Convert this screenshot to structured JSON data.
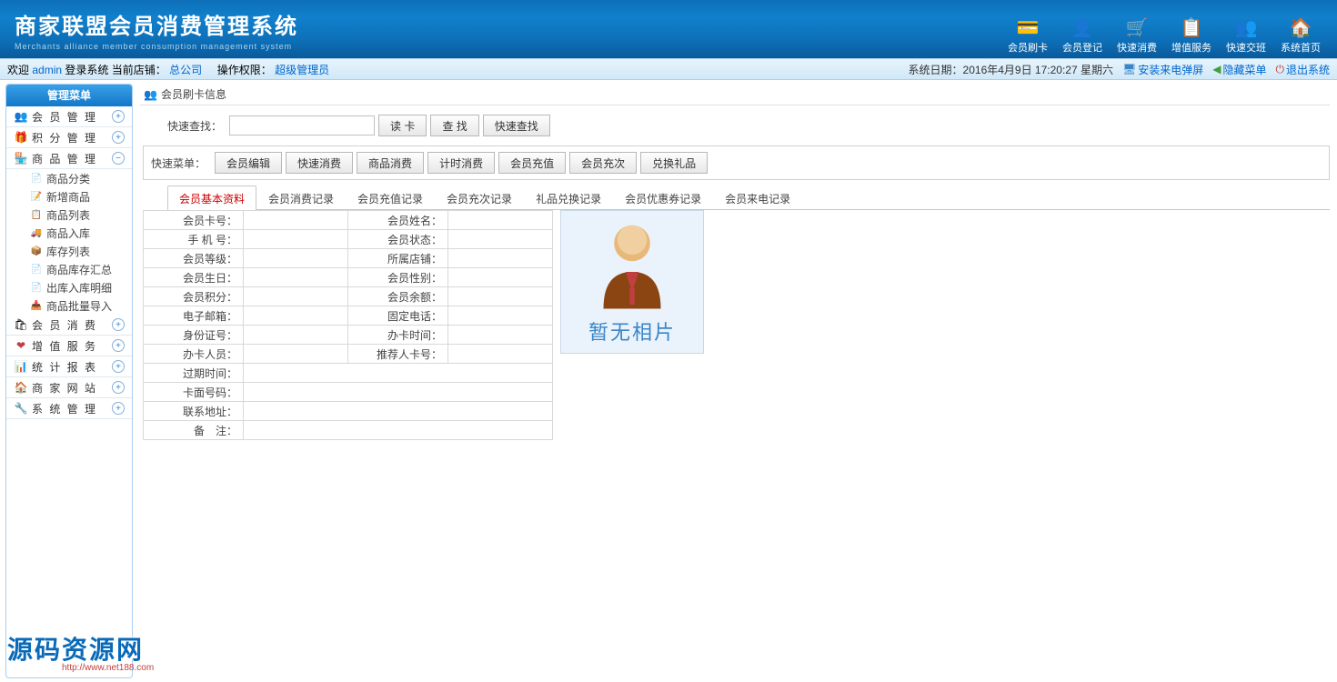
{
  "header": {
    "title_main": "商家联盟会员消费管理系统",
    "title_sub": "Merchants alliance member consumption management system",
    "nav": [
      {
        "label": "会员刷卡",
        "icon": "💳"
      },
      {
        "label": "会员登记",
        "icon": "👤"
      },
      {
        "label": "快速消费",
        "icon": "🛒"
      },
      {
        "label": "增值服务",
        "icon": "📋"
      },
      {
        "label": "快速交班",
        "icon": "👥"
      },
      {
        "label": "系统首页",
        "icon": "🏠"
      }
    ]
  },
  "status": {
    "welcome": "欢迎",
    "user": "admin",
    "login_text": "登录系统",
    "store_label": "当前店铺：",
    "store": "总公司",
    "perm_label": "操作权限：",
    "perm": "超级管理员",
    "date_label": "系统日期：",
    "date": "2016年4月9日 17:20:27 星期六",
    "links": [
      {
        "label": "安装来电弹屏",
        "icon": "🖥"
      },
      {
        "label": "隐藏菜单",
        "icon": "◀"
      },
      {
        "label": "退出系统",
        "icon": "⏻"
      }
    ]
  },
  "sidebar": {
    "title": "管理菜单",
    "items": [
      {
        "label": "会 员 管 理",
        "icon": "👥",
        "icon_class": "ic-brown",
        "expanded": false
      },
      {
        "label": "积 分 管 理",
        "icon": "🎁",
        "icon_class": "ic-orange",
        "expanded": false
      },
      {
        "label": "商 品 管 理",
        "icon": "🏪",
        "icon_class": "ic-brown",
        "expanded": true,
        "children": [
          {
            "label": "商品分类",
            "icon": "📄"
          },
          {
            "label": "新增商品",
            "icon": "📝"
          },
          {
            "label": "商品列表",
            "icon": "📋"
          },
          {
            "label": "商品入库",
            "icon": "🚚"
          },
          {
            "label": "库存列表",
            "icon": "📦"
          },
          {
            "label": "商品库存汇总",
            "icon": "📄"
          },
          {
            "label": "出库入库明细",
            "icon": "📄"
          },
          {
            "label": "商品批量导入",
            "icon": "📥"
          }
        ]
      },
      {
        "label": "会 员 消 费",
        "icon": "🛍",
        "icon_class": "",
        "expanded": false
      },
      {
        "label": "增 值 服 务",
        "icon": "❤",
        "icon_class": "ic-red",
        "expanded": false
      },
      {
        "label": "统 计 报 表",
        "icon": "📊",
        "icon_class": "ic-blue",
        "expanded": false
      },
      {
        "label": "商 家 网 站",
        "icon": "🏠",
        "icon_class": "ic-brown",
        "expanded": false
      },
      {
        "label": "系 统 管 理",
        "icon": "🔧",
        "icon_class": "",
        "expanded": false
      }
    ]
  },
  "content": {
    "header_title": "会员刷卡信息",
    "search_label": "快速查找：",
    "search_placeholder": "",
    "btn_read": "读  卡",
    "btn_find": "查  找",
    "btn_quick": "快速查找",
    "quick_menu_label": "快速菜单：",
    "quick_buttons": [
      "会员编辑",
      "快速消费",
      "商品消费",
      "计时消费",
      "会员充值",
      "会员充次",
      "兑换礼品"
    ],
    "tabs": [
      "会员基本资料",
      "会员消费记录",
      "会员充值记录",
      "会员充次记录",
      "礼品兑换记录",
      "会员优惠券记录",
      "会员来电记录"
    ],
    "active_tab": 0,
    "detail_rows_left": [
      "会员卡号：",
      "手 机 号：",
      "会员等级：",
      "会员生日：",
      "会员积分：",
      "电子邮箱：",
      "身份证号：",
      "办卡人员：",
      "过期时间：",
      "卡面号码：",
      "联系地址：",
      "备　注："
    ],
    "detail_rows_right": [
      "会员姓名：",
      "会员状态：",
      "所属店铺：",
      "会员性别：",
      "会员余额：",
      "固定电话：",
      "办卡时间：",
      "推荐人卡号："
    ],
    "photo_text": "暂无相片"
  },
  "watermark": {
    "main": "源码资源网",
    "sub": "http://www.net188.com"
  }
}
